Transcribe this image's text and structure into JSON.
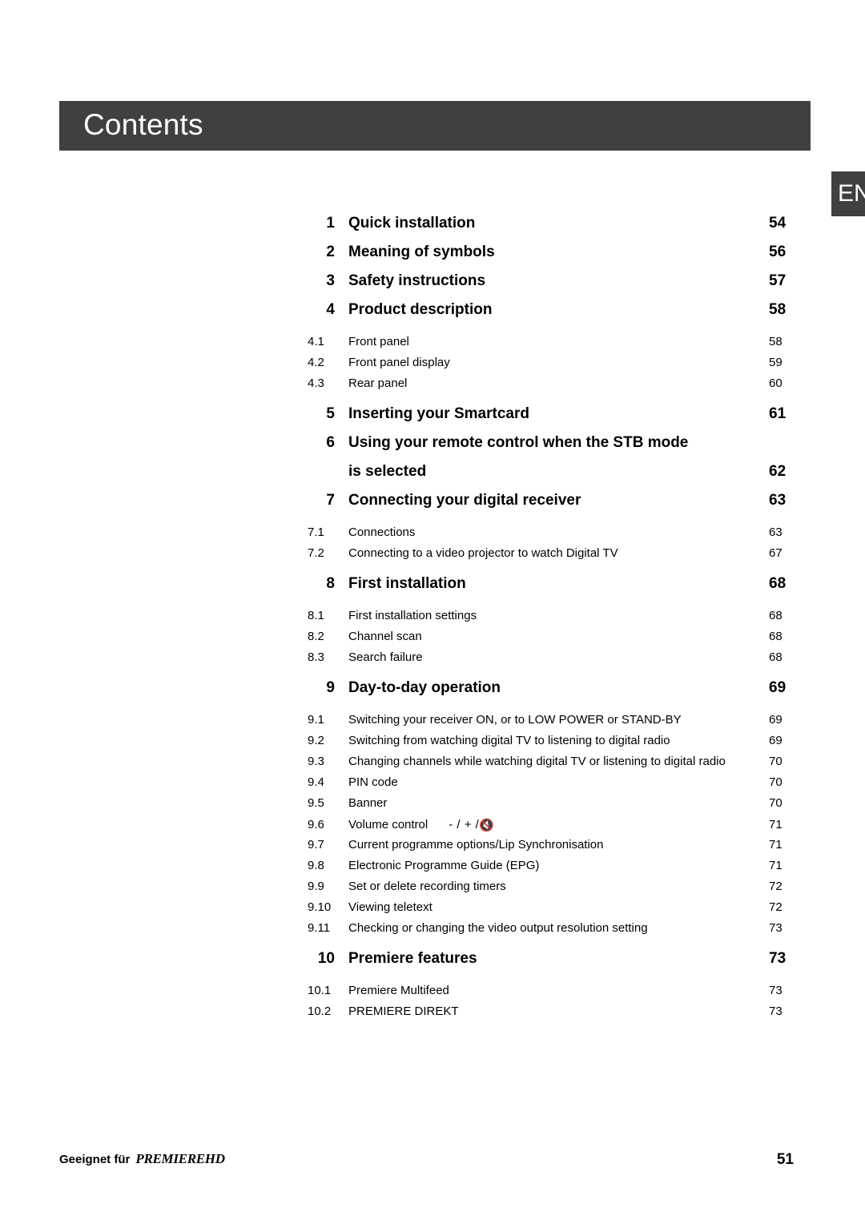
{
  "header": {
    "title": "Contents"
  },
  "language_tab": {
    "label": "EN"
  },
  "toc": {
    "entries": [
      {
        "num": "1",
        "title": "Quick installation",
        "page": "54",
        "level": "major"
      },
      {
        "num": "2",
        "title": "Meaning of symbols",
        "page": "56",
        "level": "major"
      },
      {
        "num": "3",
        "title": "Safety instructions",
        "page": "57",
        "level": "major"
      },
      {
        "num": "4",
        "title": "Product description",
        "page": "58",
        "level": "major"
      },
      {
        "num": "4.1",
        "title": "Front panel",
        "page": "58",
        "level": "sub"
      },
      {
        "num": "4.2",
        "title": "Front panel display",
        "page": "59",
        "level": "sub"
      },
      {
        "num": "4.3",
        "title": "Rear panel",
        "page": "60",
        "level": "sub"
      },
      {
        "num": "5",
        "title": "Inserting your Smartcard",
        "page": "61",
        "level": "major"
      },
      {
        "num": "6",
        "title": "Using your remote control when the STB mode",
        "page": "",
        "level": "major"
      },
      {
        "num": "",
        "title": "is selected",
        "page": "62",
        "level": "major"
      },
      {
        "num": "7",
        "title": "Connecting your digital receiver",
        "page": "63",
        "level": "major"
      },
      {
        "num": "7.1",
        "title": "Connections",
        "page": "63",
        "level": "sub"
      },
      {
        "num": "7.2",
        "title": "Connecting to a video projector to watch Digital TV",
        "page": "67",
        "level": "sub"
      },
      {
        "num": "8",
        "title": "First installation",
        "page": "68",
        "level": "major"
      },
      {
        "num": "8.1",
        "title": "First installation settings",
        "page": "68",
        "level": "sub"
      },
      {
        "num": "8.2",
        "title": "Channel scan",
        "page": "68",
        "level": "sub"
      },
      {
        "num": "8.3",
        "title": "Search failure",
        "page": "68",
        "level": "sub"
      },
      {
        "num": "9",
        "title": "Day-to-day operation",
        "page": "69",
        "level": "major"
      },
      {
        "num": "9.1",
        "title": "Switching your receiver ON, or to LOW POWER or STAND-BY",
        "page": "69",
        "level": "sub"
      },
      {
        "num": "9.2",
        "title": "Switching from watching digital TV to listening to digital radio",
        "page": "69",
        "level": "sub"
      },
      {
        "num": "9.3",
        "title": "Changing channels while watching digital TV or listening to digital radio",
        "page": "70",
        "level": "sub"
      },
      {
        "num": "9.4",
        "title": "PIN code",
        "page": "70",
        "level": "sub"
      },
      {
        "num": "9.5",
        "title": "Banner",
        "page": "70",
        "level": "sub"
      },
      {
        "num": "9.6",
        "title": "Volume control",
        "page": "71",
        "level": "sub",
        "symbols": "- /   + /"
      },
      {
        "num": "9.7",
        "title": "Current programme options/Lip Synchronisation",
        "page": "71",
        "level": "sub"
      },
      {
        "num": "9.8",
        "title": "Electronic Programme Guide (EPG)",
        "page": "71",
        "level": "sub"
      },
      {
        "num": "9.9",
        "title": "Set or delete recording timers",
        "page": "72",
        "level": "sub"
      },
      {
        "num": "9.10",
        "title": "Viewing teletext",
        "page": "72",
        "level": "sub"
      },
      {
        "num": "9.11",
        "title": "Checking or changing the video output resolution setting",
        "page": "73",
        "level": "sub"
      },
      {
        "num": "10",
        "title": "Premiere features",
        "page": "73",
        "level": "major"
      },
      {
        "num": "10.1",
        "title": "Premiere Multifeed",
        "page": "73",
        "level": "sub"
      },
      {
        "num": "10.2",
        "title": "PREMIERE DIREKT",
        "page": "73",
        "level": "sub"
      }
    ]
  },
  "footer": {
    "compat_text": "Geeignet für",
    "brand": "PREMIERE",
    "brand_suffix": "HD",
    "page_number": "51"
  },
  "colors": {
    "header_bg": "#404040",
    "header_text": "#ffffff",
    "body_text": "#000000"
  }
}
